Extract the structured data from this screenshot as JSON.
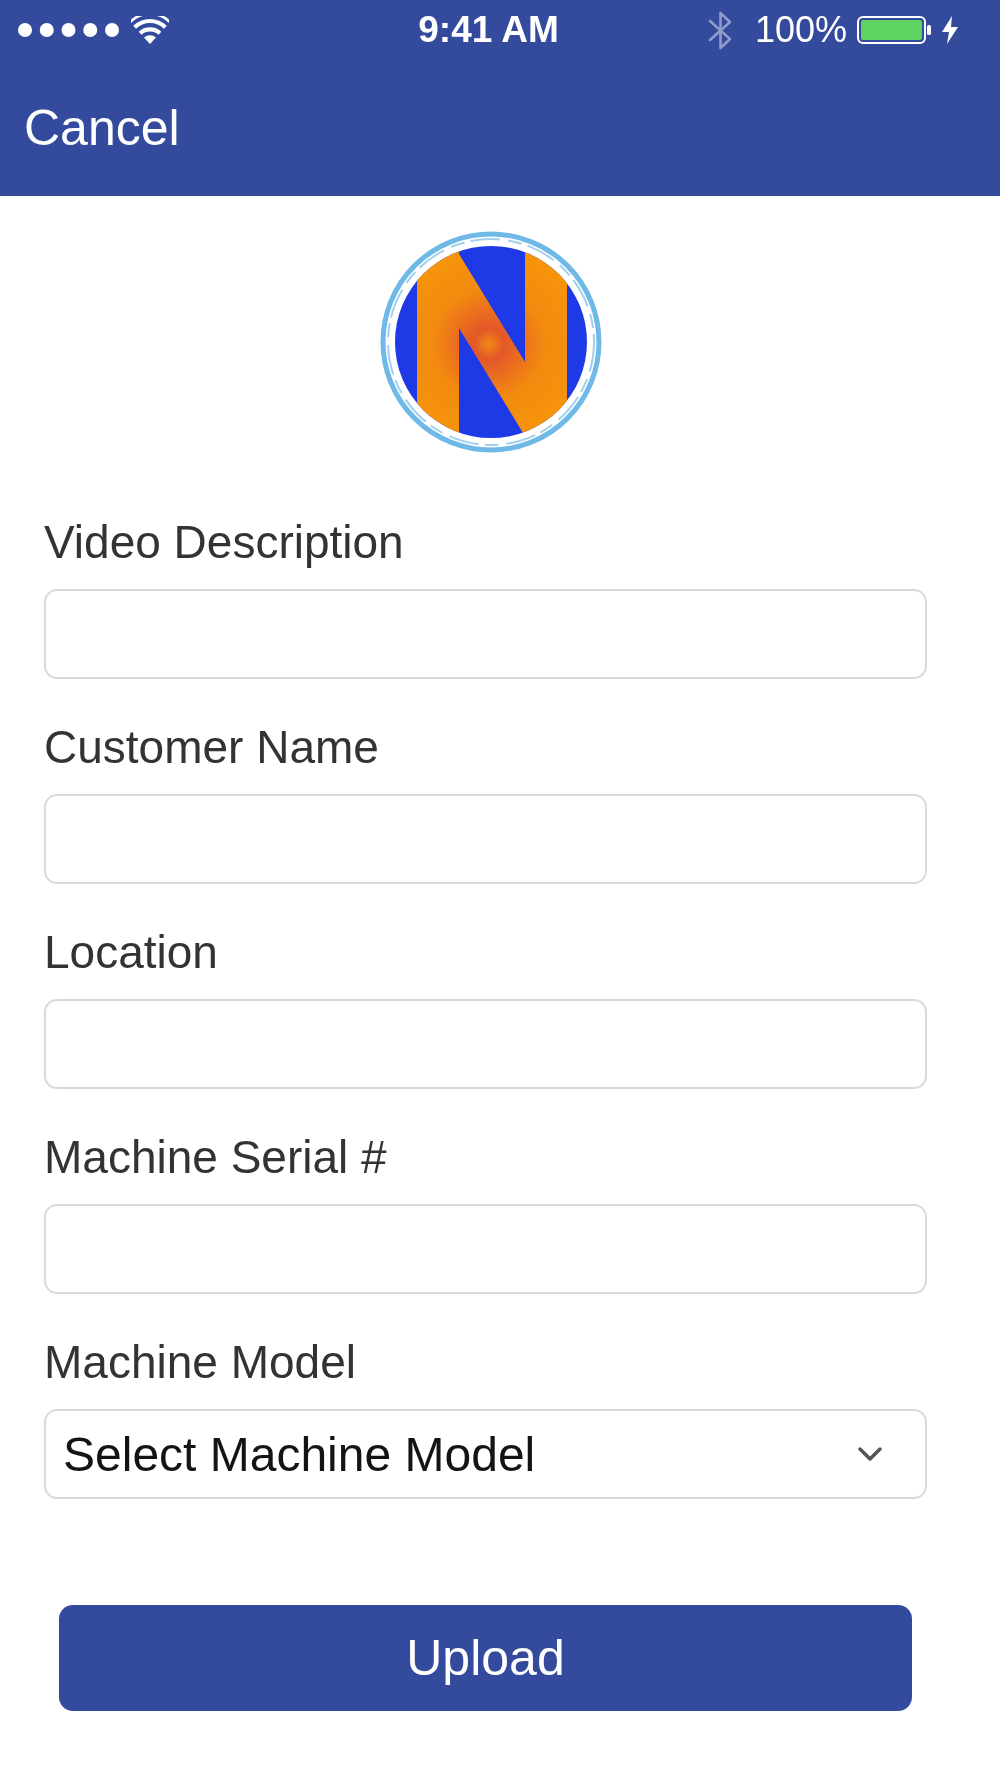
{
  "status_bar": {
    "time": "9:41 AM",
    "battery": "100%"
  },
  "nav_bar": {
    "cancel_button": "Cancel"
  },
  "form": {
    "fields": [
      {
        "kind": "text",
        "label": "Video Description"
      },
      {
        "kind": "text",
        "label": "Customer Name"
      },
      {
        "kind": "text",
        "label": "Location"
      },
      {
        "kind": "text",
        "label": "Machine Serial #"
      },
      {
        "kind": "select",
        "label": "Machine Model",
        "value": "Select Machine Model"
      }
    ]
  },
  "upload_button": "Upload"
}
